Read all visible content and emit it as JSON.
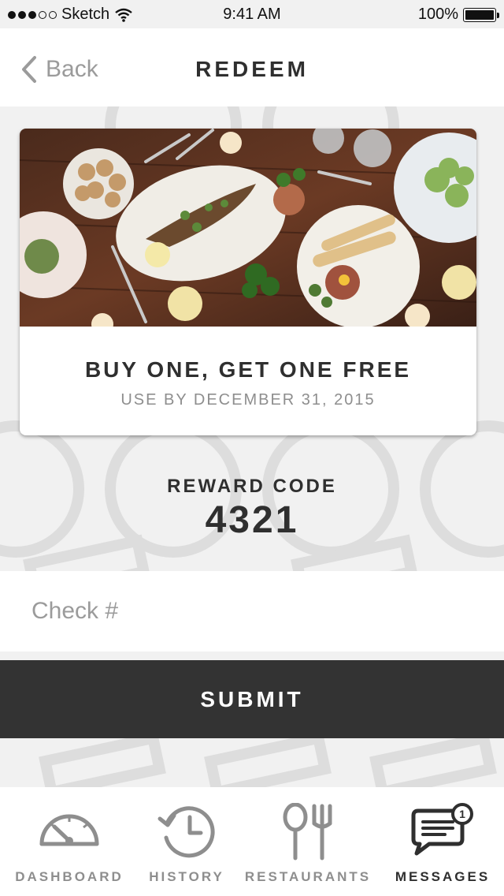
{
  "status_bar": {
    "carrier": "Sketch",
    "time": "9:41 AM",
    "battery": "100%"
  },
  "nav": {
    "back_label": "Back",
    "title": "REDEEM"
  },
  "offer": {
    "title": "BUY ONE, GET ONE FREE",
    "expiry": "USE BY DECEMBER 31, 2015"
  },
  "reward": {
    "label": "REWARD CODE",
    "code": "4321"
  },
  "check": {
    "placeholder": "Check #",
    "value": ""
  },
  "submit_label": "SUBMIT",
  "tabs": [
    {
      "label": "DASHBOARD",
      "icon": "gauge-icon",
      "active": false
    },
    {
      "label": "HISTORY",
      "icon": "history-icon",
      "active": false
    },
    {
      "label": "RESTAURANTS",
      "icon": "fork-spoon-icon",
      "active": false
    },
    {
      "label": "MESSAGES",
      "icon": "message-icon",
      "active": true,
      "badge": "1"
    }
  ],
  "colors": {
    "background": "#f1f1f1",
    "primary_dark": "#333333",
    "text_dark": "#2f2f2f",
    "text_muted": "#8e8e8e"
  }
}
